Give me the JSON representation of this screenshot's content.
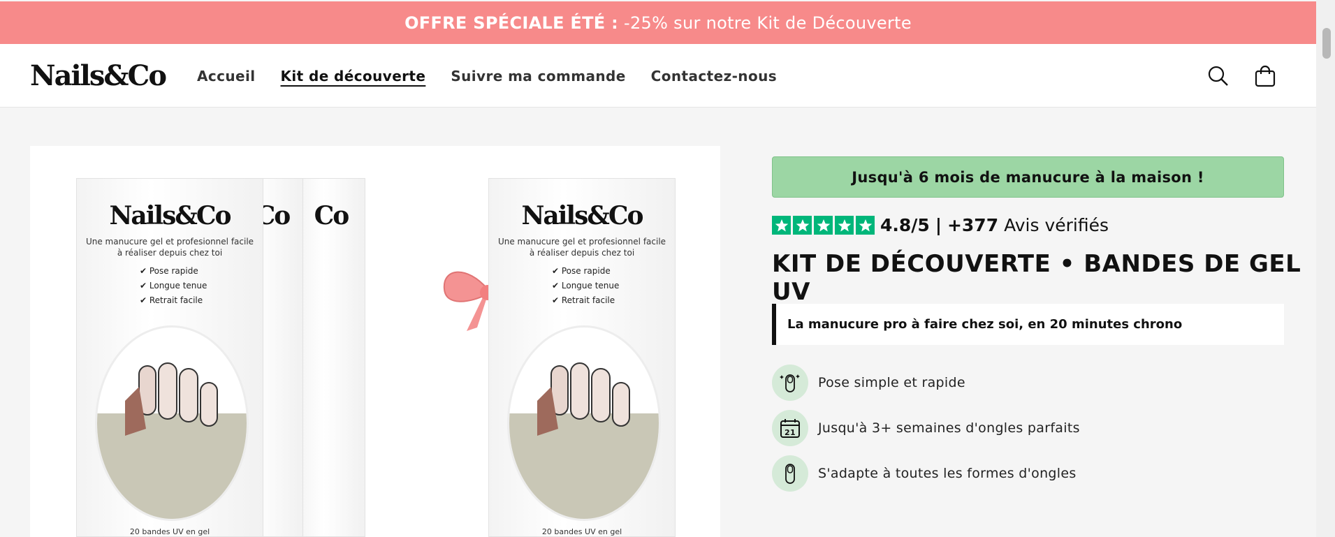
{
  "announcement": {
    "bold": "OFFRE SPÉCIALE ÉTÉ :",
    "text": "-25% sur notre Kit de Découverte"
  },
  "header": {
    "logo": "Nails&Co",
    "nav": [
      {
        "label": "Accueil"
      },
      {
        "label": "Kit de découverte",
        "active": true
      },
      {
        "label": "Suivre ma commande"
      },
      {
        "label": "Contactez-nous"
      }
    ],
    "icons": [
      "search-icon",
      "cart-icon"
    ]
  },
  "gallery": {
    "box_logo": "Nails&Co",
    "box_subtitle_line1": "Une manucure gel et profesionnel facile",
    "box_subtitle_line2": "à réaliser depuis chez toi",
    "box_features": [
      "Pose rapide",
      "Longue tenue",
      "Retrait facile"
    ],
    "box_footer": "20 bandes UV en gel"
  },
  "product": {
    "promo": "Jusqu'à 6 mois de manucure à la maison !",
    "rating_value": "4.8/5",
    "rating_separator": "|",
    "review_count": "+377",
    "review_label": "Avis vérifiés",
    "stars": 5,
    "title": "KIT DE DÉCOUVERTE • BANDES DE GEL UV",
    "tagline": "La manucure pro à faire chez soi, en 20 minutes chrono",
    "features": [
      {
        "icon": "nail-sparkle-icon",
        "label": "Pose simple et rapide"
      },
      {
        "icon": "calendar-21-icon",
        "label": "Jusqu'à 3+ semaines d'ongles parfaits"
      },
      {
        "icon": "fingernail-icon",
        "label": "S'adapte à toutes les formes d'ongles"
      }
    ]
  },
  "colors": {
    "announcement_bg": "#f78a8a",
    "promo_bg": "#9cd6a4",
    "trustpilot_green": "#00b67a"
  }
}
